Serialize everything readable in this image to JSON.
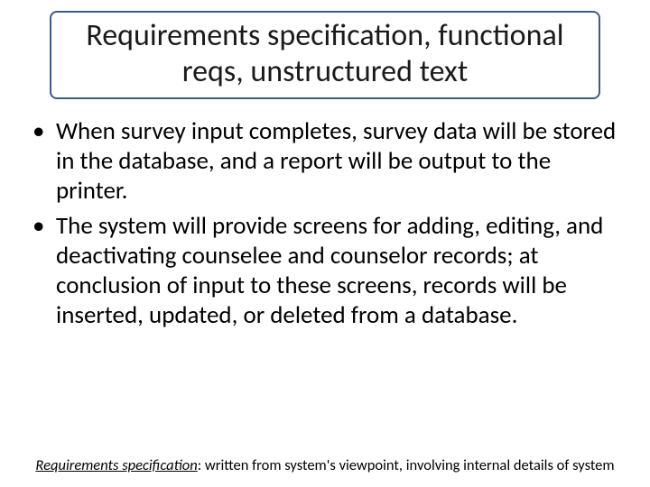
{
  "title": {
    "text": "Requirements specification, functional reqs, unstructured text"
  },
  "bullets": {
    "items": [
      {
        "text": "When survey input completes, survey data will be stored in the database, and a report will be output to the printer."
      },
      {
        "text": "The system will provide screens for adding, editing, and deactivating counselee and counselor records; at conclusion of input to these screens, records will be inserted, updated, or deleted from a database."
      }
    ]
  },
  "footer": {
    "term": "Requirements specification",
    "rest": ": written from system's viewpoint, involving internal details of system"
  }
}
